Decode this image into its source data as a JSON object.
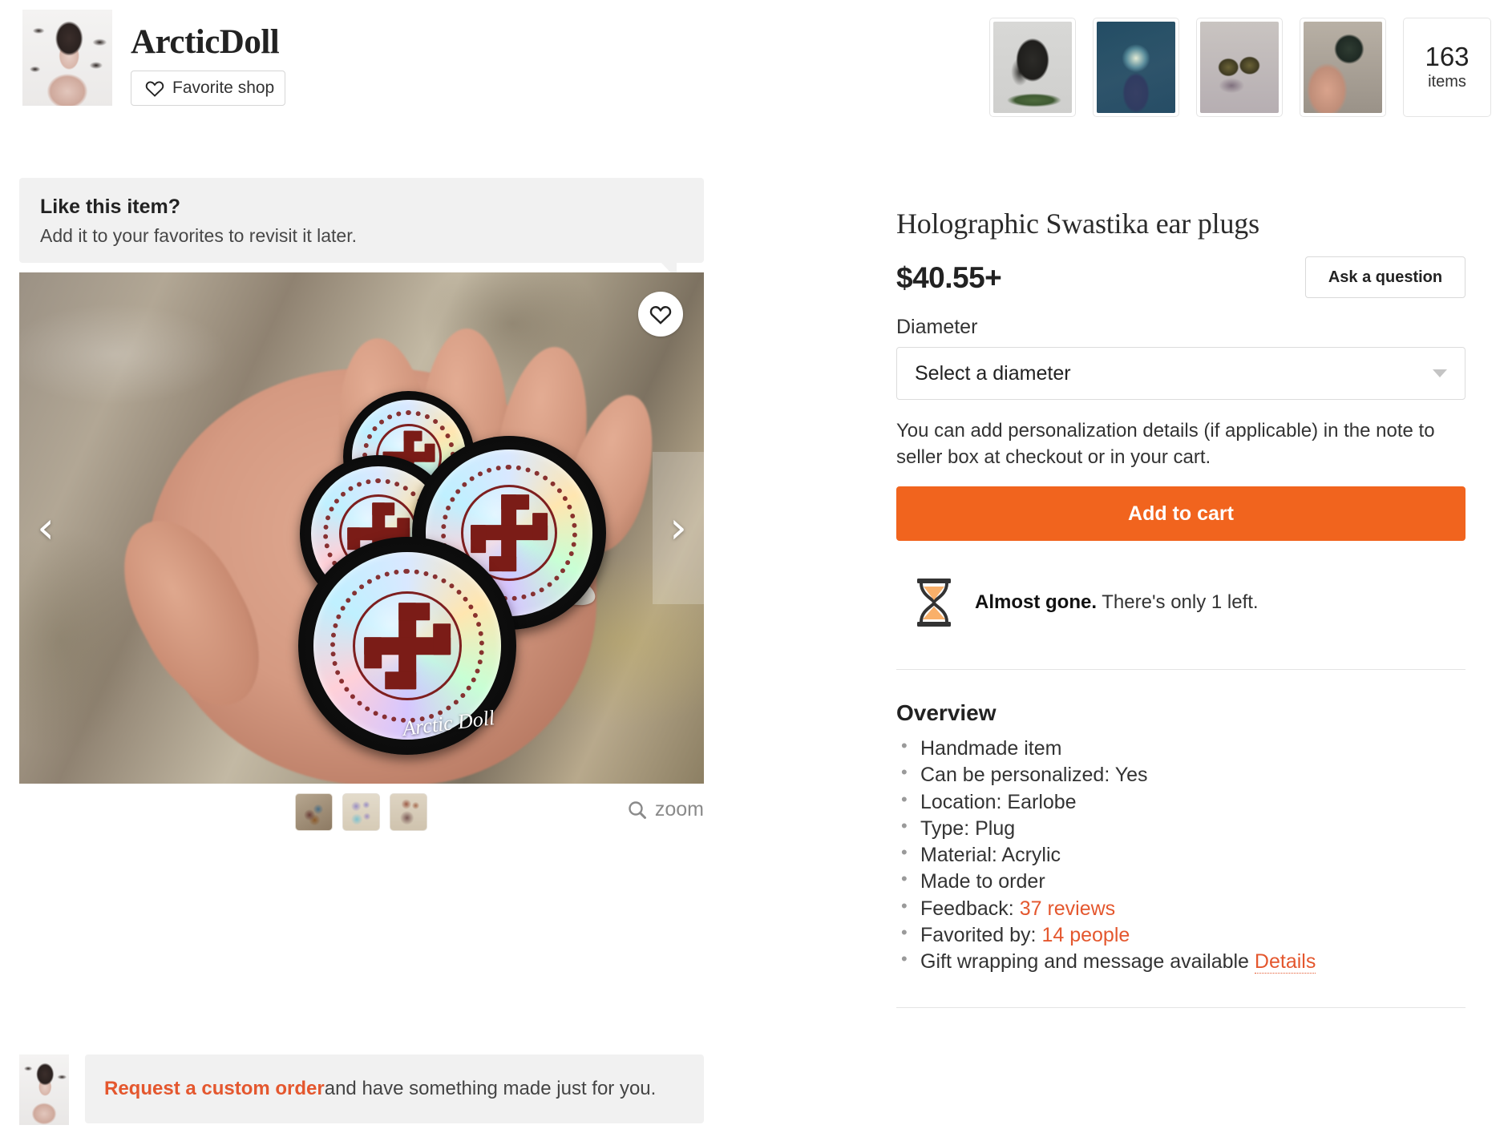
{
  "header": {
    "shop_name": "ArcticDoll",
    "favorite_shop_label": "Favorite shop",
    "avatar_name": "shop-avatar",
    "thumbnails": [
      {
        "name": "gorilla-figurine-thumbnail"
      },
      {
        "name": "pokeball-terrarium-thumbnail"
      },
      {
        "name": "moss-plugs-thumbnail"
      },
      {
        "name": "hand-holding-plug-thumbnail"
      }
    ],
    "items_count": "163",
    "items_label": "items"
  },
  "callout": {
    "title": "Like this item?",
    "subtitle": "Add it to your favorites to revisit it later."
  },
  "gallery": {
    "watermark": "Arctic Doll",
    "prev_label": "‹",
    "next_label": "›",
    "zoom_label": "zoom",
    "thumbnails": [
      {
        "name": "gallery-thumb-1"
      },
      {
        "name": "gallery-thumb-2"
      },
      {
        "name": "gallery-thumb-3"
      }
    ]
  },
  "custom_order": {
    "link_text": "Request a custom order",
    "rest_text": " and have something made just for you."
  },
  "listing": {
    "title": "Holographic Swastika ear plugs",
    "price": "$40.55+",
    "ask_question_label": "Ask a question",
    "option_label": "Diameter",
    "option_selected": "Select a diameter",
    "personalization_note": "You can add personalization details (if applicable) in the note to seller box at checkout or in your cart.",
    "add_to_cart_label": "Add to cart",
    "scarcity_bold": "Almost gone.",
    "scarcity_rest": " There's only 1 left.",
    "overview_title": "Overview",
    "overview": [
      {
        "text": "Handmade item"
      },
      {
        "text": "Can be personalized: Yes"
      },
      {
        "text": "Location: Earlobe"
      },
      {
        "text": "Type: Plug"
      },
      {
        "text": "Material: Acrylic"
      },
      {
        "text": "Made to order"
      },
      {
        "prefix": "Feedback: ",
        "link": "37 reviews"
      },
      {
        "prefix": "Favorited by: ",
        "link": "14 people"
      },
      {
        "prefix": "Gift wrapping and message available ",
        "link": "Details"
      }
    ]
  },
  "colors": {
    "accent_orange": "#f1641e",
    "link_orange": "#e4572e",
    "panel_gray": "#f1f1f1"
  }
}
